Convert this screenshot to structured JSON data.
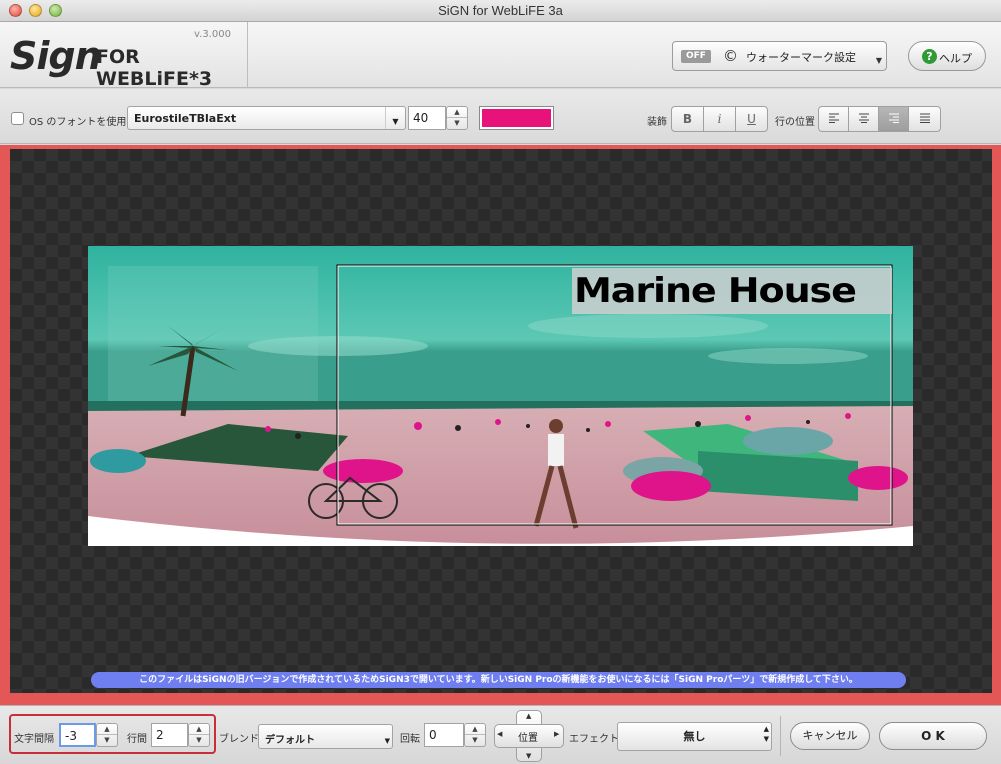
{
  "window": {
    "title": "SiGN for WebLiFE 3a"
  },
  "header": {
    "logo_version": "v.3.000",
    "logo_main": "Sign",
    "logo_sub": "FOR WEBLiFE*3",
    "watermark": {
      "toggle": "OFF",
      "symbol": "©",
      "label": "ウォーターマーク設定"
    },
    "help_icon": "?",
    "help_label": "ヘルプ"
  },
  "toolbar": {
    "os_font_label": "OS のフォントを使用",
    "font_name": "EurostileTBlaExt",
    "font_size": "40",
    "text_color": "#e8137a",
    "decoration_label": "装飾",
    "bold": "B",
    "italic": "i",
    "underline": "U",
    "align_label": "行の位置",
    "align_active": "right"
  },
  "canvas": {
    "banner_text": "Marine House",
    "notice": "このファイルはSiGNの旧バージョンで作成されているためSiGN3で開いています。新しいSiGN Proの新機能をお使いになるには「SiGN Proパーツ」で新規作成して下さい。"
  },
  "bottombar": {
    "letter_spacing_label": "文字間隔",
    "letter_spacing_value": "-3",
    "line_spacing_label": "行間",
    "line_spacing_value": "2",
    "blend_label": "ブレンド",
    "blend_value": "デフォルト",
    "rotation_label": "回転",
    "rotation_value": "0",
    "position_label": "位置",
    "effect_label": "エフェクト",
    "effect_value": "無し",
    "cancel_label": "キャンセル",
    "ok_label": "O K"
  }
}
